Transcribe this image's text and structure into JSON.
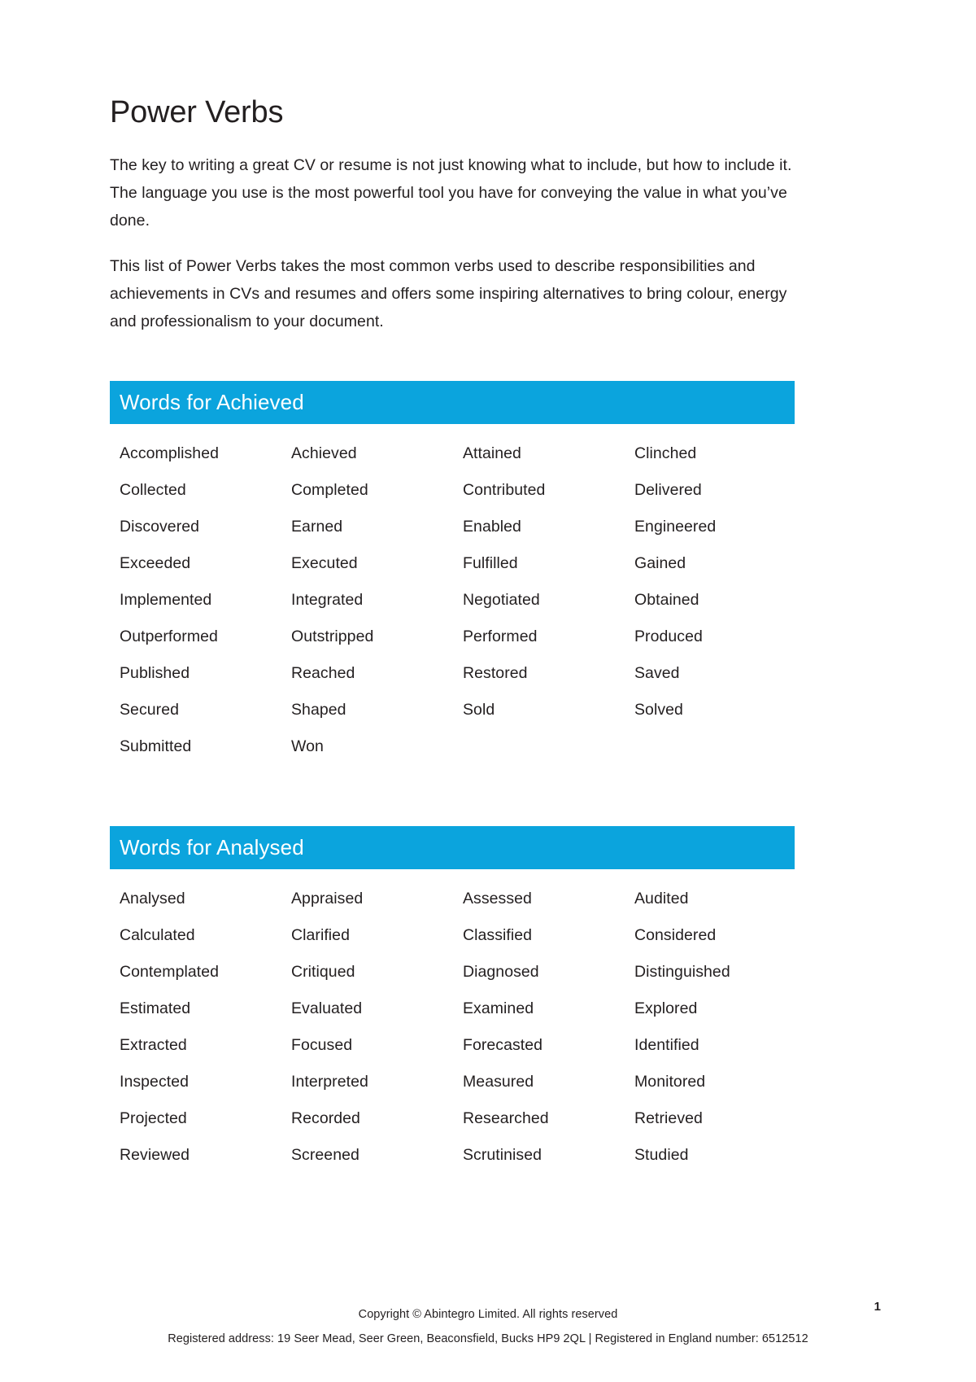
{
  "document": {
    "title": "Power Verbs",
    "intro_paragraphs": [
      "The key to writing a great CV or resume is not just knowing what to include, but how to include it. The language you use is the most powerful tool you have for conveying the value in what you’ve done.",
      "This list of Power Verbs takes the most common verbs used to describe responsibilities and achievements in CVs and resumes and offers some inspiring alternatives to bring colour, energy and professionalism to your document."
    ],
    "accent_color": "#0ba4dd",
    "text_color": "#231f20"
  },
  "sections": [
    {
      "heading": "Words for Achieved",
      "words": [
        "Accomplished",
        "Achieved",
        "Attained",
        "Clinched",
        "Collected",
        "Completed",
        "Contributed",
        "Delivered",
        "Discovered",
        "Earned",
        "Enabled",
        "Engineered",
        "Exceeded",
        "Executed",
        "Fulfilled",
        "Gained",
        "Implemented",
        "Integrated",
        "Negotiated",
        "Obtained",
        "Outperformed",
        "Outstripped",
        "Performed",
        "Produced",
        "Published",
        "Reached",
        "Restored",
        "Saved",
        "Secured",
        "Shaped",
        "Sold",
        "Solved",
        "Submitted",
        "Won",
        "",
        ""
      ]
    },
    {
      "heading": "Words for Analysed",
      "words": [
        "Analysed",
        "Appraised",
        "Assessed",
        "Audited",
        "Calculated",
        "Clarified",
        "Classified",
        "Considered",
        "Contemplated",
        "Critiqued",
        "Diagnosed",
        "Distinguished",
        "Estimated",
        "Evaluated",
        "Examined",
        "Explored",
        "Extracted",
        "Focused",
        "Forecasted",
        "Identified",
        "Inspected",
        "Interpreted",
        "Measured",
        "Monitored",
        "Projected",
        "Recorded",
        "Researched",
        "Retrieved",
        "Reviewed",
        "Screened",
        "Scrutinised",
        "Studied"
      ]
    }
  ],
  "footer": {
    "copyright": "Copyright © Abintegro Limited. All rights reserved",
    "registration": "Registered address: 19 Seer Mead, Seer Green, Beaconsfield, Bucks HP9 2QL | Registered in England number: 6512512",
    "page_number": "1"
  }
}
